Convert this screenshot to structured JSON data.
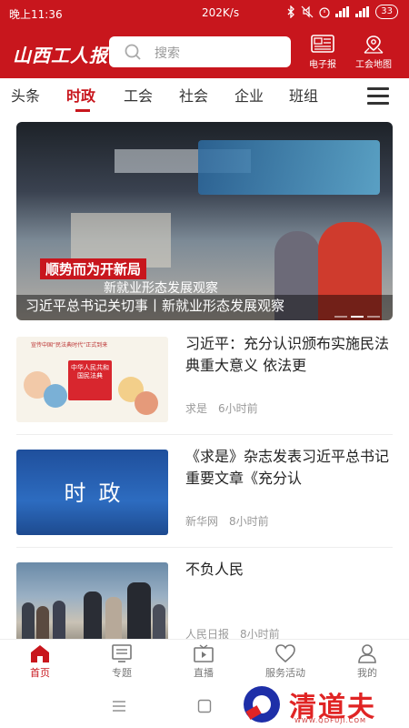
{
  "status_bar": {
    "time": "晚上11:36",
    "speed": "202K/s",
    "battery": "33"
  },
  "app_bar": {
    "logo": "山西工人报",
    "search_placeholder": "搜索",
    "epaper_label": "电子报",
    "union_map_label": "工会地图"
  },
  "tabs": [
    {
      "label": "头条"
    },
    {
      "label": "时政"
    },
    {
      "label": "工会"
    },
    {
      "label": "社会"
    },
    {
      "label": "企业"
    },
    {
      "label": "班组"
    }
  ],
  "active_tab": "时政",
  "hero": {
    "overlay_title": "顺势而为开新局",
    "overlay_subtitle": "新就业形态发展观察",
    "caption": "习近平总书记关切事丨新就业形态发展观察",
    "dots_total": 3,
    "dots_active": 1
  },
  "news": [
    {
      "title": "习近平：充分认识颁布实施民法典重大意义 依法更",
      "source": "求是",
      "time": "6小时前",
      "thumb_text": "中华人民共和国民法典",
      "thumb_headline": "宣传中国“民法典时代”正式到来"
    },
    {
      "title": "《求是》杂志发表习近平总书记重要文章《充分认",
      "source": "新华网",
      "time": "8小时前",
      "thumb_text": "时政"
    },
    {
      "title": "不负人民",
      "source": "人民日报",
      "time": "8小时前"
    }
  ],
  "bottom_nav": [
    {
      "label": "首页",
      "icon": "home-icon"
    },
    {
      "label": "专题",
      "icon": "topic-icon"
    },
    {
      "label": "直播",
      "icon": "live-icon"
    },
    {
      "label": "服务活动",
      "icon": "heart-icon"
    },
    {
      "label": "我的",
      "icon": "user-icon"
    }
  ],
  "active_nav": "首页",
  "watermark": {
    "text": "清道夫",
    "url": "WWW.QDFUJI.COM"
  },
  "colors": {
    "brand_red": "#c8161d",
    "text_dark": "#222222",
    "text_meta": "#999999"
  }
}
